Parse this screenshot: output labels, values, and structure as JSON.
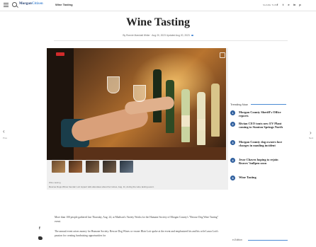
{
  "header": {
    "logo_main": "Morgan",
    "logo_accent": "Citizen",
    "section": "Wine Tasting",
    "share_label": "SHARE THIS",
    "share_icons": [
      "f",
      "t",
      "e",
      "in",
      "p"
    ]
  },
  "article": {
    "title": "Wine Tasting",
    "byline": "By Ronnie Marshall Writer · Aug 20, 2023 Updated Aug 20, 2023",
    "gallery_caption_title": "Wine tasting",
    "gallery_caption": "Rescue Dogs Wines founder Lori Lippert tells attendees about her wines, Aug. 11, during the wine tasting event.",
    "paragraphs": [
      "More than 100 people gathered last Thursday, Aug. 24, at Madison's Variety Works for the Humane Society of Morgan County's \"Rescue Dog Wine Tasting\" event.",
      "The annual event raises money for Humane Society. Rescue Dog Wines co-owner Blair Lott spoke at the event and emphasized his and his wife Laura Lott's passion for creating fundraising opportunities for"
    ]
  },
  "trending": {
    "heading": "Trending Now",
    "items": [
      {
        "num": "1",
        "text": "Morgan County Sheriff's Office reports"
      },
      {
        "num": "2",
        "text": "Rivian CEO touts new EV Plant coming to Stanton Springs North"
      },
      {
        "num": "3",
        "text": "Morgan County dog owners face charges in mauling incident"
      },
      {
        "num": "4",
        "text": "Jesse Chavez hoping to rejoin Braves' bullpen soon"
      },
      {
        "num": "5",
        "text": "Wine Tasting"
      }
    ]
  },
  "nav": {
    "prev_label": "Prev",
    "next_label": "Next"
  },
  "sidebar": {
    "eedition": "e-Edition"
  },
  "colors": {
    "accent": "#4a8ad4",
    "brand": "#1d3a6e",
    "trend_badge": "#2f5f9e"
  }
}
